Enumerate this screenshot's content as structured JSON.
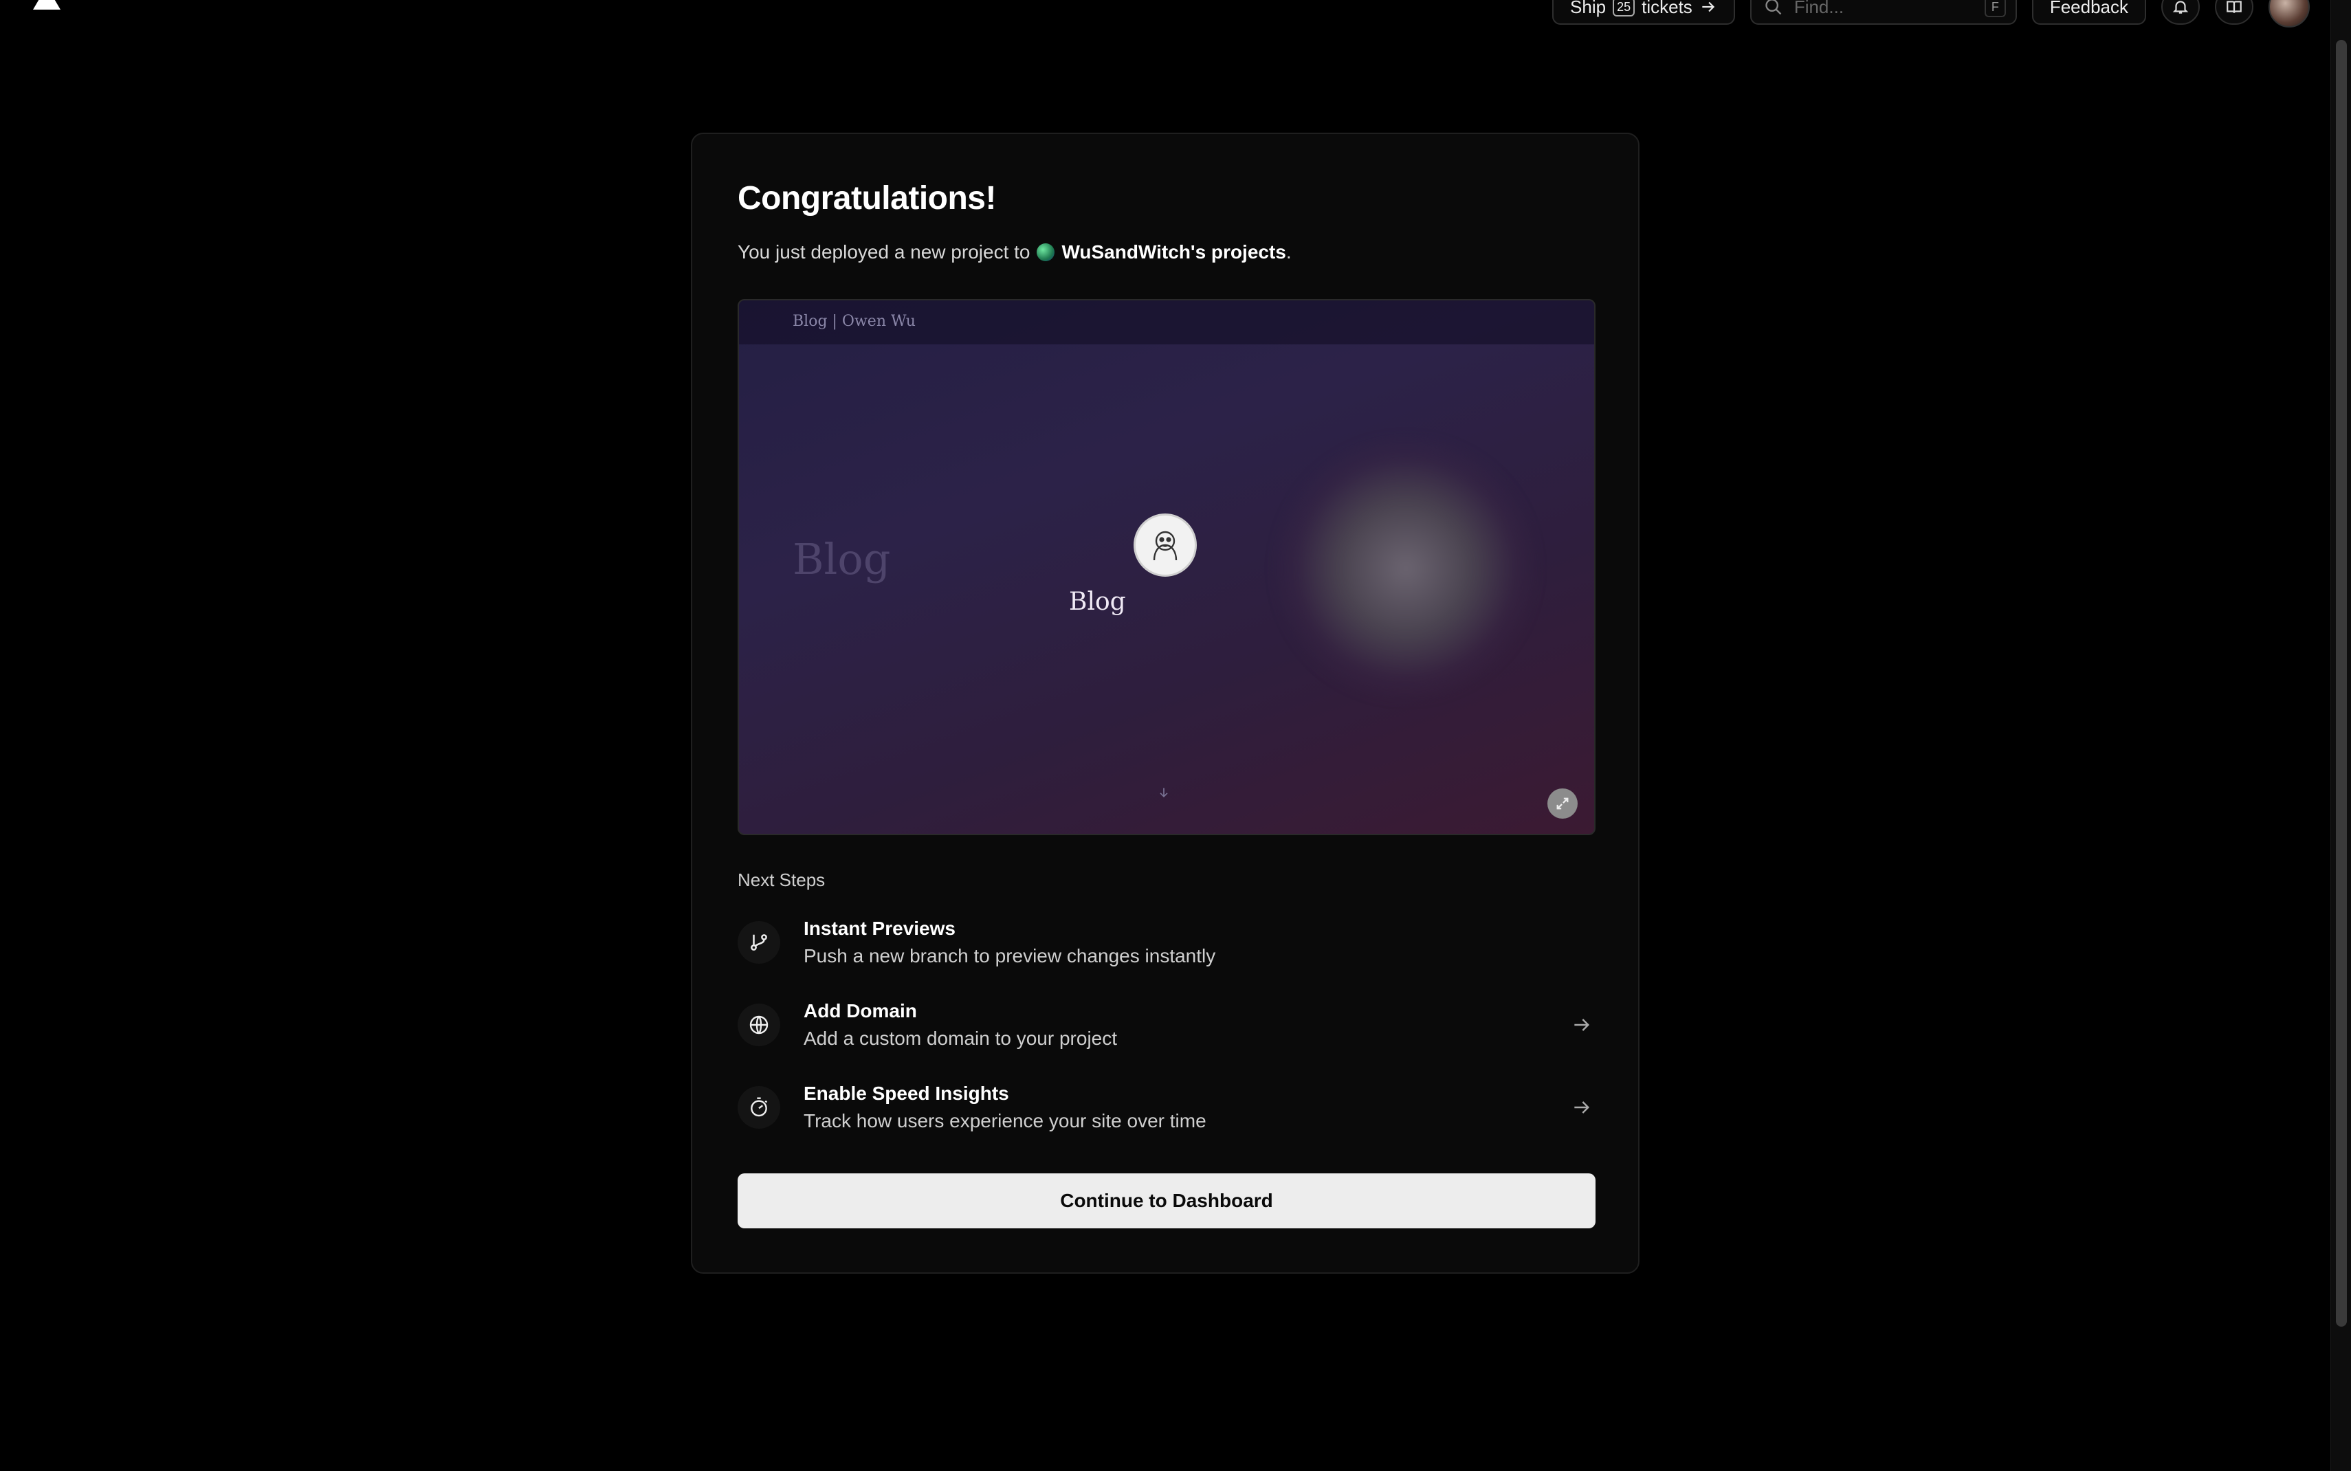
{
  "topbar": {
    "ship_label_prefix": "Ship",
    "ship_count": "25",
    "ship_label_suffix": "tickets",
    "search_placeholder": "Find...",
    "search_shortcut": "F",
    "feedback_label": "Feedback"
  },
  "card": {
    "title": "Congratulations!",
    "subtitle_prefix": "You just deployed a new project to",
    "team_name": "WuSandWitch's projects",
    "subtitle_suffix": "."
  },
  "preview": {
    "site_header": "Blog | Owen Wu",
    "ghost_text": "Blog",
    "title": "Blog"
  },
  "next_steps": {
    "label": "Next Steps",
    "items": [
      {
        "title": "Instant Previews",
        "description": "Push a new branch to preview changes instantly",
        "icon": "git-branch-icon"
      },
      {
        "title": "Add Domain",
        "description": "Add a custom domain to your project",
        "icon": "globe-icon"
      },
      {
        "title": "Enable Speed Insights",
        "description": "Track how users experience your site over time",
        "icon": "stopwatch-icon"
      }
    ]
  },
  "cta_label": "Continue to Dashboard",
  "colors": {
    "background": "#000000",
    "card": "#0a0a0a",
    "button": "#ededed"
  }
}
